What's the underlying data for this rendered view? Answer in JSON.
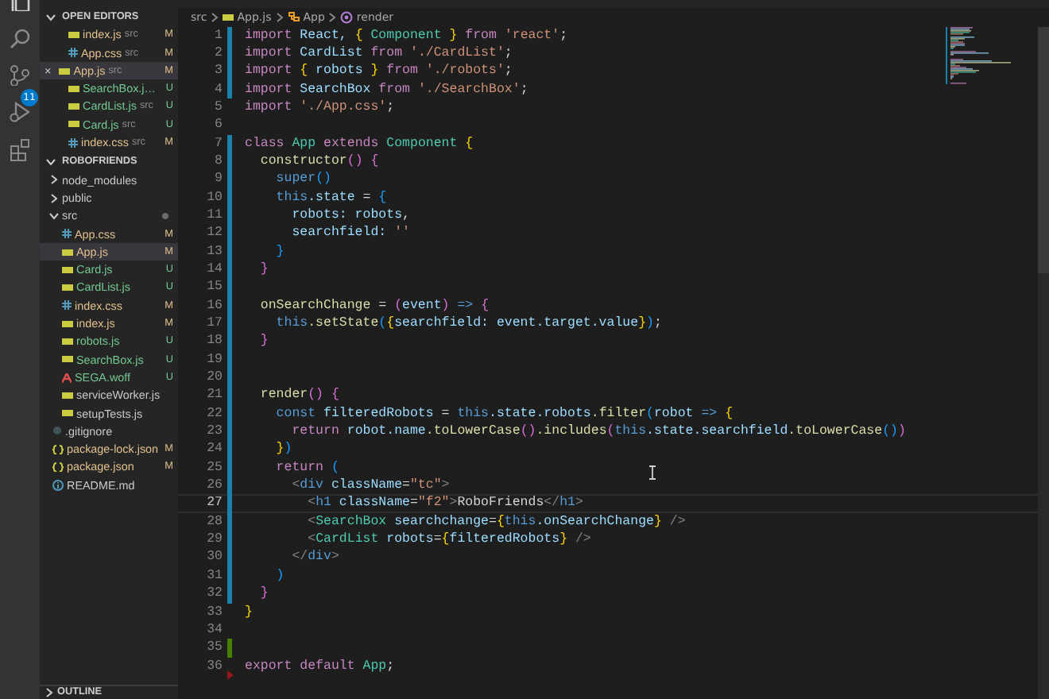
{
  "activity_bar": {
    "source_control_badge": "11"
  },
  "open_editors": {
    "title": "OPEN EDITORS",
    "items": [
      {
        "name": "index.js",
        "folder": "src",
        "status": "M",
        "kind": "js",
        "selected": false
      },
      {
        "name": "App.css",
        "folder": "src",
        "status": "M",
        "kind": "css",
        "selected": false
      },
      {
        "name": "App.js",
        "folder": "src",
        "status": "M",
        "kind": "js",
        "selected": true,
        "close": "×"
      },
      {
        "name": "SearchBox.j…",
        "status": "U",
        "kind": "js",
        "selected": false
      },
      {
        "name": "CardList.js",
        "folder": "src",
        "status": "U",
        "kind": "js",
        "selected": false
      },
      {
        "name": "Card.js",
        "folder": "src",
        "status": "U",
        "kind": "js",
        "selected": false
      },
      {
        "name": "index.css",
        "folder": "src",
        "status": "M",
        "kind": "css",
        "selected": false
      }
    ]
  },
  "explorer": {
    "title": "ROBOFRIENDS",
    "items": [
      {
        "name": "node_modules",
        "kind": "folder",
        "expanded": false,
        "selected": false
      },
      {
        "name": "public",
        "kind": "folder",
        "expanded": false,
        "selected": false
      },
      {
        "name": "src",
        "kind": "folder",
        "expanded": true,
        "selected": false,
        "has_changes": true,
        "children": [
          {
            "name": "App.css",
            "kind": "css",
            "status": "M",
            "selected": false
          },
          {
            "name": "App.js",
            "kind": "js",
            "status": "M",
            "selected": true
          },
          {
            "name": "Card.js",
            "kind": "js",
            "status": "U",
            "selected": false
          },
          {
            "name": "CardList.js",
            "kind": "js",
            "status": "U",
            "selected": false
          },
          {
            "name": "index.css",
            "kind": "css",
            "status": "M",
            "selected": false
          },
          {
            "name": "index.js",
            "kind": "js",
            "status": "M",
            "selected": false
          },
          {
            "name": "robots.js",
            "kind": "js",
            "status": "U",
            "selected": false
          },
          {
            "name": "SearchBox.js",
            "kind": "js",
            "status": "U",
            "selected": false
          },
          {
            "name": "SEGA.woff",
            "kind": "font",
            "status": "U",
            "selected": false
          },
          {
            "name": "serviceWorker.js",
            "kind": "js",
            "selected": false
          },
          {
            "name": "setupTests.js",
            "kind": "js",
            "selected": false
          }
        ]
      },
      {
        "name": ".gitignore",
        "kind": "git",
        "selected": false
      },
      {
        "name": "package-lock.json",
        "kind": "json",
        "status": "M",
        "selected": false
      },
      {
        "name": "package.json",
        "kind": "json",
        "status": "M",
        "selected": false
      },
      {
        "name": "README.md",
        "kind": "info",
        "selected": false
      }
    ]
  },
  "outline": {
    "title": "OUTLINE",
    "expanded": false
  },
  "breadcrumb": [
    {
      "text": "src",
      "kind": "folder"
    },
    {
      "text": "App.js",
      "kind": "js"
    },
    {
      "text": "App",
      "kind": "class"
    },
    {
      "text": "render",
      "kind": "method"
    }
  ],
  "code_lines": [
    {
      "number": "1",
      "kind": "modified",
      "tokens": [
        {
          "text": "import",
          "kind": "kw"
        },
        {
          "text": " React, ",
          "kind": "id"
        },
        {
          "text": "{",
          "kind": "b1"
        },
        {
          "text": " Component ",
          "kind": "cls"
        },
        {
          "text": "}",
          "kind": "b1"
        },
        {
          "text": " from ",
          "kind": "kw"
        },
        {
          "text": "'react'",
          "kind": "str"
        },
        {
          "text": ";",
          "kind": "punc"
        }
      ]
    },
    {
      "number": "2",
      "kind": "modified",
      "tokens": [
        {
          "text": "import",
          "kind": "kw"
        },
        {
          "text": " CardList ",
          "kind": "id"
        },
        {
          "text": "from ",
          "kind": "kw"
        },
        {
          "text": "'./CardList'",
          "kind": "str"
        },
        {
          "text": ";",
          "kind": "punc"
        }
      ]
    },
    {
      "number": "3",
      "kind": "modified",
      "tokens": [
        {
          "text": "import ",
          "kind": "kw"
        },
        {
          "text": "{",
          "kind": "b1"
        },
        {
          "text": " robots ",
          "kind": "id"
        },
        {
          "text": "}",
          "kind": "b1"
        },
        {
          "text": " from ",
          "kind": "kw"
        },
        {
          "text": "'./robots'",
          "kind": "str"
        },
        {
          "text": ";",
          "kind": "punc"
        }
      ]
    },
    {
      "number": "4",
      "kind": "modified",
      "tokens": [
        {
          "text": "import ",
          "kind": "kw"
        },
        {
          "text": "SearchBox ",
          "kind": "id"
        },
        {
          "text": "from ",
          "kind": "kw"
        },
        {
          "text": "'./SearchBox'",
          "kind": "str"
        },
        {
          "text": ";",
          "kind": "punc"
        }
      ]
    },
    {
      "number": "5",
      "kind": "unchanged",
      "tokens": [
        {
          "text": "import ",
          "kind": "kw"
        },
        {
          "text": "'./App.css'",
          "kind": "str"
        },
        {
          "text": ";",
          "kind": "punc"
        }
      ]
    },
    {
      "number": "6",
      "kind": "unchanged"
    },
    {
      "number": "7",
      "kind": "modified",
      "tokens": [
        {
          "text": "class ",
          "kind": "kw"
        },
        {
          "text": "App ",
          "kind": "cls"
        },
        {
          "text": "extends ",
          "kind": "kw"
        },
        {
          "text": "Component ",
          "kind": "cls"
        },
        {
          "text": "{",
          "kind": "b1"
        }
      ]
    },
    {
      "number": "8",
      "kind": "modified",
      "tokens": [
        {
          "text": "  constructor",
          "kind": "fn"
        },
        {
          "text": "() {",
          "kind": "b2"
        }
      ]
    },
    {
      "number": "9",
      "kind": "modified",
      "tokens": [
        {
          "text": "    super",
          "kind": "this"
        },
        {
          "text": "()",
          "kind": "b3"
        }
      ]
    },
    {
      "number": "10",
      "kind": "modified",
      "tokens": [
        {
          "text": "    this",
          "kind": "this"
        },
        {
          "text": ".state ",
          "kind": "id"
        },
        {
          "text": "= ",
          "kind": "punc"
        },
        {
          "text": "{",
          "kind": "b3"
        }
      ]
    },
    {
      "number": "11",
      "kind": "modified",
      "tokens": [
        {
          "text": "      robots: robots",
          "kind": "id"
        },
        {
          "text": ",",
          "kind": "punc"
        }
      ]
    },
    {
      "number": "12",
      "kind": "modified",
      "tokens": [
        {
          "text": "      searchfield: ",
          "kind": "id"
        },
        {
          "text": "''",
          "kind": "str"
        }
      ]
    },
    {
      "number": "13",
      "kind": "modified",
      "tokens": [
        {
          "text": "    }",
          "kind": "b3"
        }
      ]
    },
    {
      "number": "14",
      "kind": "modified",
      "tokens": [
        {
          "text": "  }",
          "kind": "b2"
        }
      ]
    },
    {
      "number": "15",
      "kind": "modified"
    },
    {
      "number": "16",
      "kind": "modified",
      "tokens": [
        {
          "text": "  onSearchChange ",
          "kind": "fn"
        },
        {
          "text": "= ",
          "kind": "punc"
        },
        {
          "text": "(",
          "kind": "b2"
        },
        {
          "text": "event",
          "kind": "id"
        },
        {
          "text": ")",
          "kind": "b2"
        },
        {
          "text": " => ",
          "kind": "this"
        },
        {
          "text": "{",
          "kind": "b2"
        }
      ]
    },
    {
      "number": "17",
      "kind": "modified",
      "tokens": [
        {
          "text": "    this",
          "kind": "this"
        },
        {
          "text": ".setState",
          "kind": "fn"
        },
        {
          "text": "(",
          "kind": "b3"
        },
        {
          "text": "{",
          "kind": "b1"
        },
        {
          "text": "searchfield: event.target.value",
          "kind": "id"
        },
        {
          "text": "}",
          "kind": "b1"
        },
        {
          "text": ")",
          "kind": "b3"
        },
        {
          "text": ";",
          "kind": "punc"
        }
      ]
    },
    {
      "number": "18",
      "kind": "modified",
      "tokens": [
        {
          "text": "  }",
          "kind": "b2"
        }
      ]
    },
    {
      "number": "19",
      "kind": "modified"
    },
    {
      "number": "20",
      "kind": "modified"
    },
    {
      "number": "21",
      "kind": "modified",
      "tokens": [
        {
          "text": "  render",
          "kind": "fn"
        },
        {
          "text": "() {",
          "kind": "b2"
        }
      ]
    },
    {
      "number": "22",
      "kind": "modified",
      "tokens": [
        {
          "text": "    const ",
          "kind": "this"
        },
        {
          "text": "filteredRobots ",
          "kind": "id"
        },
        {
          "text": "= ",
          "kind": "punc"
        },
        {
          "text": "this",
          "kind": "this"
        },
        {
          "text": ".state.robots",
          "kind": "id"
        },
        {
          "text": ".filter",
          "kind": "fn"
        },
        {
          "text": "(",
          "kind": "b3"
        },
        {
          "text": "robot ",
          "kind": "id"
        },
        {
          "text": "=> ",
          "kind": "this"
        },
        {
          "text": "{",
          "kind": "b1"
        }
      ]
    },
    {
      "number": "23",
      "kind": "modified",
      "tokens": [
        {
          "text": "      return ",
          "kind": "kw"
        },
        {
          "text": "robot.name",
          "kind": "id"
        },
        {
          "text": ".toLowerCase",
          "kind": "fn"
        },
        {
          "text": "()",
          "kind": "b2"
        },
        {
          "text": ".includes",
          "kind": "fn"
        },
        {
          "text": "(",
          "kind": "b2"
        },
        {
          "text": "this",
          "kind": "this"
        },
        {
          "text": ".state.searchfield",
          "kind": "id"
        },
        {
          "text": ".toLowerCase",
          "kind": "fn"
        },
        {
          "text": "()",
          "kind": "b3"
        },
        {
          "text": ")",
          "kind": "b2"
        }
      ]
    },
    {
      "number": "24",
      "kind": "modified",
      "tokens": [
        {
          "text": "    }",
          "kind": "b1"
        },
        {
          "text": ")",
          "kind": "b3"
        }
      ]
    },
    {
      "number": "25",
      "kind": "modified",
      "tokens": [
        {
          "text": "    return ",
          "kind": "kw"
        },
        {
          "text": "(",
          "kind": "b3"
        }
      ]
    },
    {
      "number": "26",
      "kind": "modified",
      "tokens": [
        {
          "text": "      <",
          "kind": "tag"
        },
        {
          "text": "div ",
          "kind": "this"
        },
        {
          "text": "className",
          "kind": "id"
        },
        {
          "text": "=",
          "kind": "punc"
        },
        {
          "text": "\"tc\"",
          "kind": "str"
        },
        {
          "text": ">",
          "kind": "tag"
        }
      ]
    },
    {
      "number": "27",
      "kind": "modified",
      "current": true,
      "tokens": [
        {
          "text": "        <",
          "kind": "tag"
        },
        {
          "text": "h1 ",
          "kind": "this"
        },
        {
          "text": "className",
          "kind": "id"
        },
        {
          "text": "=",
          "kind": "punc"
        },
        {
          "text": "\"f2\"",
          "kind": "str"
        },
        {
          "text": ">",
          "kind": "tag"
        },
        {
          "text": "RoboFriends",
          "kind": "punc"
        },
        {
          "text": "</",
          "kind": "tag"
        },
        {
          "text": "h1",
          "kind": "this"
        },
        {
          "text": ">",
          "kind": "tag"
        }
      ]
    },
    {
      "number": "28",
      "kind": "modified",
      "tokens": [
        {
          "text": "        <",
          "kind": "tag"
        },
        {
          "text": "SearchBox ",
          "kind": "cls"
        },
        {
          "text": "searchchange",
          "kind": "id"
        },
        {
          "text": "=",
          "kind": "punc"
        },
        {
          "text": "{",
          "kind": "b1"
        },
        {
          "text": "this",
          "kind": "this"
        },
        {
          "text": ".onSearchChange",
          "kind": "id"
        },
        {
          "text": "}",
          "kind": "b1"
        },
        {
          "text": " />",
          "kind": "tag"
        }
      ]
    },
    {
      "number": "29",
      "kind": "modified",
      "tokens": [
        {
          "text": "        <",
          "kind": "tag"
        },
        {
          "text": "CardList ",
          "kind": "cls"
        },
        {
          "text": "robots",
          "kind": "id"
        },
        {
          "text": "=",
          "kind": "punc"
        },
        {
          "text": "{",
          "kind": "b1"
        },
        {
          "text": "filteredRobots",
          "kind": "id"
        },
        {
          "text": "}",
          "kind": "b1"
        },
        {
          "text": " />",
          "kind": "tag"
        }
      ]
    },
    {
      "number": "30",
      "kind": "modified",
      "tokens": [
        {
          "text": "      </",
          "kind": "tag"
        },
        {
          "text": "div",
          "kind": "this"
        },
        {
          "text": ">",
          "kind": "tag"
        }
      ]
    },
    {
      "number": "31",
      "kind": "modified",
      "tokens": [
        {
          "text": "    )",
          "kind": "b3"
        }
      ]
    },
    {
      "number": "32",
      "kind": "modified",
      "tokens": [
        {
          "text": "  }",
          "kind": "b2"
        }
      ]
    },
    {
      "number": "33",
      "kind": "unchanged",
      "tokens": [
        {
          "text": "}",
          "kind": "b1"
        }
      ]
    },
    {
      "number": "34",
      "kind": "unchanged"
    },
    {
      "number": "35",
      "kind": "added"
    },
    {
      "number": "36",
      "kind": "deleted",
      "tokens": [
        {
          "text": "export default ",
          "kind": "kw"
        },
        {
          "text": "App",
          "kind": "cls"
        },
        {
          "text": ";",
          "kind": "punc"
        }
      ]
    }
  ]
}
